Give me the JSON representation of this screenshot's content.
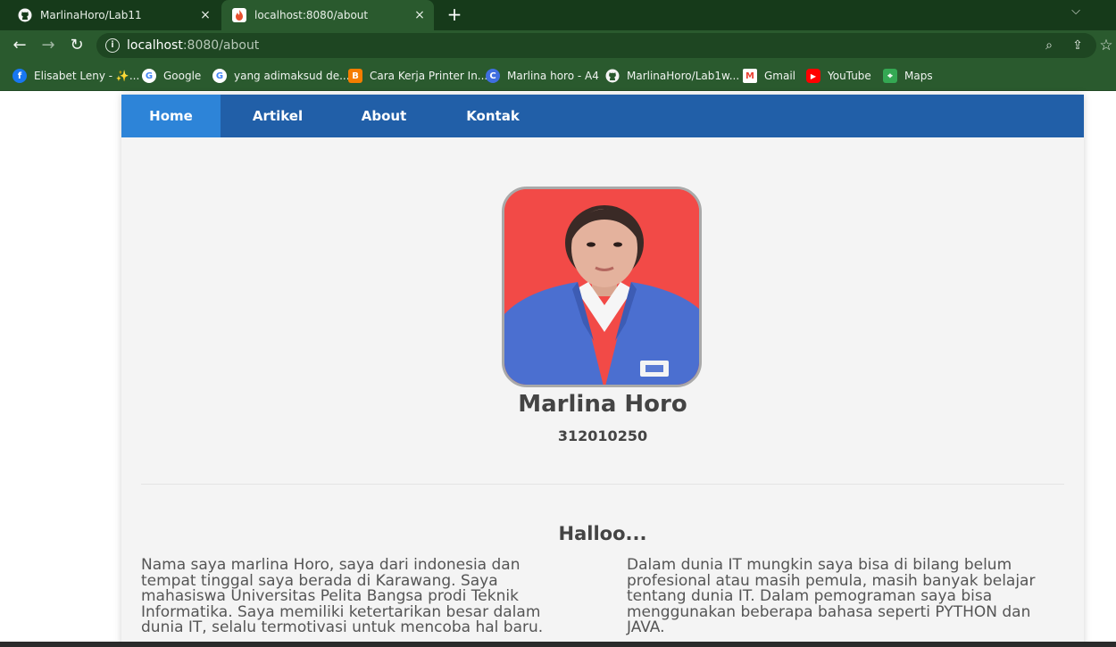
{
  "browser": {
    "tabs": [
      {
        "title": "MarlinaHoro/Lab11",
        "icon": "github-icon",
        "active": false
      },
      {
        "title": "localhost:8080/about",
        "icon": "flame-icon",
        "active": true
      }
    ],
    "new_tab": "+",
    "close": "×",
    "address": {
      "host": "localhost",
      "path": ":8080/about"
    },
    "bookmarks": [
      {
        "label": "Elisabet Leny - ✨...",
        "icon": "facebook-icon",
        "color": "#1877f2"
      },
      {
        "label": "Google",
        "icon": "google-icon",
        "color": "#ffffff"
      },
      {
        "label": "yang adimaksud de...",
        "icon": "google-icon",
        "color": "#ffffff"
      },
      {
        "label": "Cara Kerja Printer In...",
        "icon": "blogger-icon",
        "color": "#f57d00"
      },
      {
        "label": "Marlina horo - A4",
        "icon": "canva-icon",
        "color": "#3f6ee0"
      },
      {
        "label": "MarlinaHoro/Lab1w...",
        "icon": "github-icon",
        "color": "#ffffff"
      },
      {
        "label": "Gmail",
        "icon": "gmail-icon",
        "color": "#ffffff"
      },
      {
        "label": "YouTube",
        "icon": "youtube-icon",
        "color": "#ff0000"
      },
      {
        "label": "Maps",
        "icon": "maps-icon",
        "color": "#34a853"
      }
    ]
  },
  "nav": {
    "items": [
      "Home",
      "Artikel",
      "About",
      "Kontak"
    ],
    "active": "Home",
    "bar_color": "#215fa8",
    "active_color": "#2d84d8"
  },
  "profile": {
    "name": "Marlina Horo",
    "nim": "312010250"
  },
  "about": {
    "heading": "Halloo...",
    "paragraph_left": "Nama saya marlina Horo, saya dari indonesia dan tempat tinggal saya berada di Karawang. Saya mahasiswa Universitas Pelita Bangsa prodi Teknik Informatika. Saya memiliki ketertarikan besar dalam dunia IT, selalu termotivasi untuk mencoba hal baru.",
    "paragraph_right": "Dalam dunia IT mungkin saya bisa di bilang belum profesional atau masih pemula, masih banyak belajar tentang dunia IT. Dalam pemograman saya bisa menggunakan beberapa bahasa seperti PYTHON dan JAVA."
  }
}
